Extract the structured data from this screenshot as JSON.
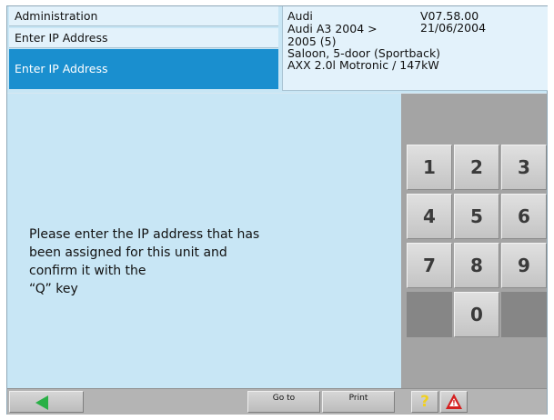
{
  "header": {
    "breadcrumb_1": "Administration",
    "breadcrumb_2": "Enter IP Address",
    "active_title": "Enter IP Address"
  },
  "vehicle": {
    "make": "Audi",
    "version": "V07.58.00 21/06/2004",
    "model": "Audi A3 2004 >",
    "year": "2005 (5)",
    "body": "Saloon, 5-door (Sportback)",
    "engine": "AXX 2.0l Motronic / 147kW"
  },
  "instruction": {
    "line1": "Please enter the IP address that has",
    "line2": "been assigned for this unit and",
    "line3": "confirm it with the",
    "line4": "“Q” key"
  },
  "keypad": {
    "k1": "1",
    "k2": "2",
    "k3": "3",
    "k4": "4",
    "k5": "5",
    "k6": "6",
    "k7": "7",
    "k8": "8",
    "k9": "9",
    "k0": "0"
  },
  "toolbar": {
    "goto_label": "Go to",
    "print_label": "Print",
    "help_label": "?"
  },
  "colors": {
    "background": "#c8e6f5",
    "active_row": "#1a8fcf",
    "keypad_bg": "#a4a4a4",
    "back_arrow": "#29b046",
    "warning": "#d42020",
    "help": "#f0d020"
  },
  "icons": {
    "back": "back-arrow-icon",
    "help": "help-icon",
    "warning": "warning-icon"
  }
}
